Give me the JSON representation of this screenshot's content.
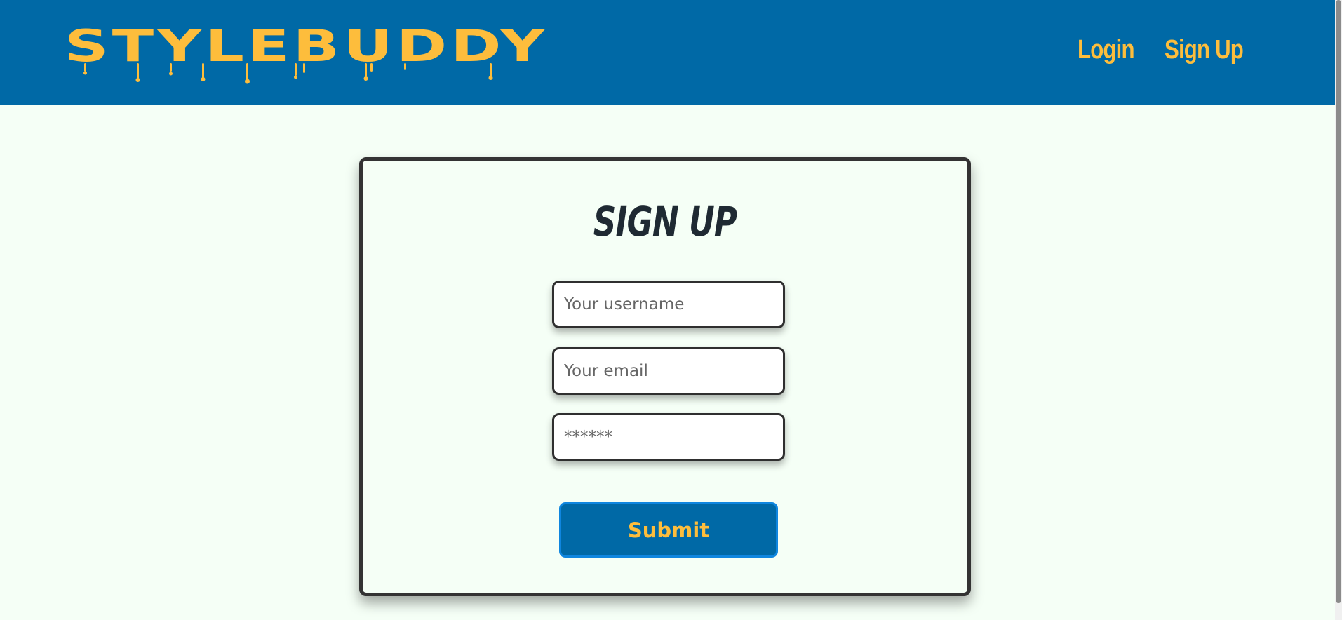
{
  "header": {
    "logo_text": "STYLEBUDDY",
    "nav": {
      "login_label": "Login",
      "signup_label": "Sign Up"
    }
  },
  "form": {
    "title": "SIGN UP",
    "username": {
      "placeholder": "Your username",
      "value": ""
    },
    "email": {
      "placeholder": "Your email",
      "value": ""
    },
    "password": {
      "placeholder": "******",
      "value": ""
    },
    "submit_label": "Submit"
  },
  "colors": {
    "header_bg": "#0069a6",
    "accent_yellow": "#fdbd3c",
    "page_bg": "#f5fff6",
    "card_border": "#333333",
    "submit_border": "#0f86df"
  }
}
